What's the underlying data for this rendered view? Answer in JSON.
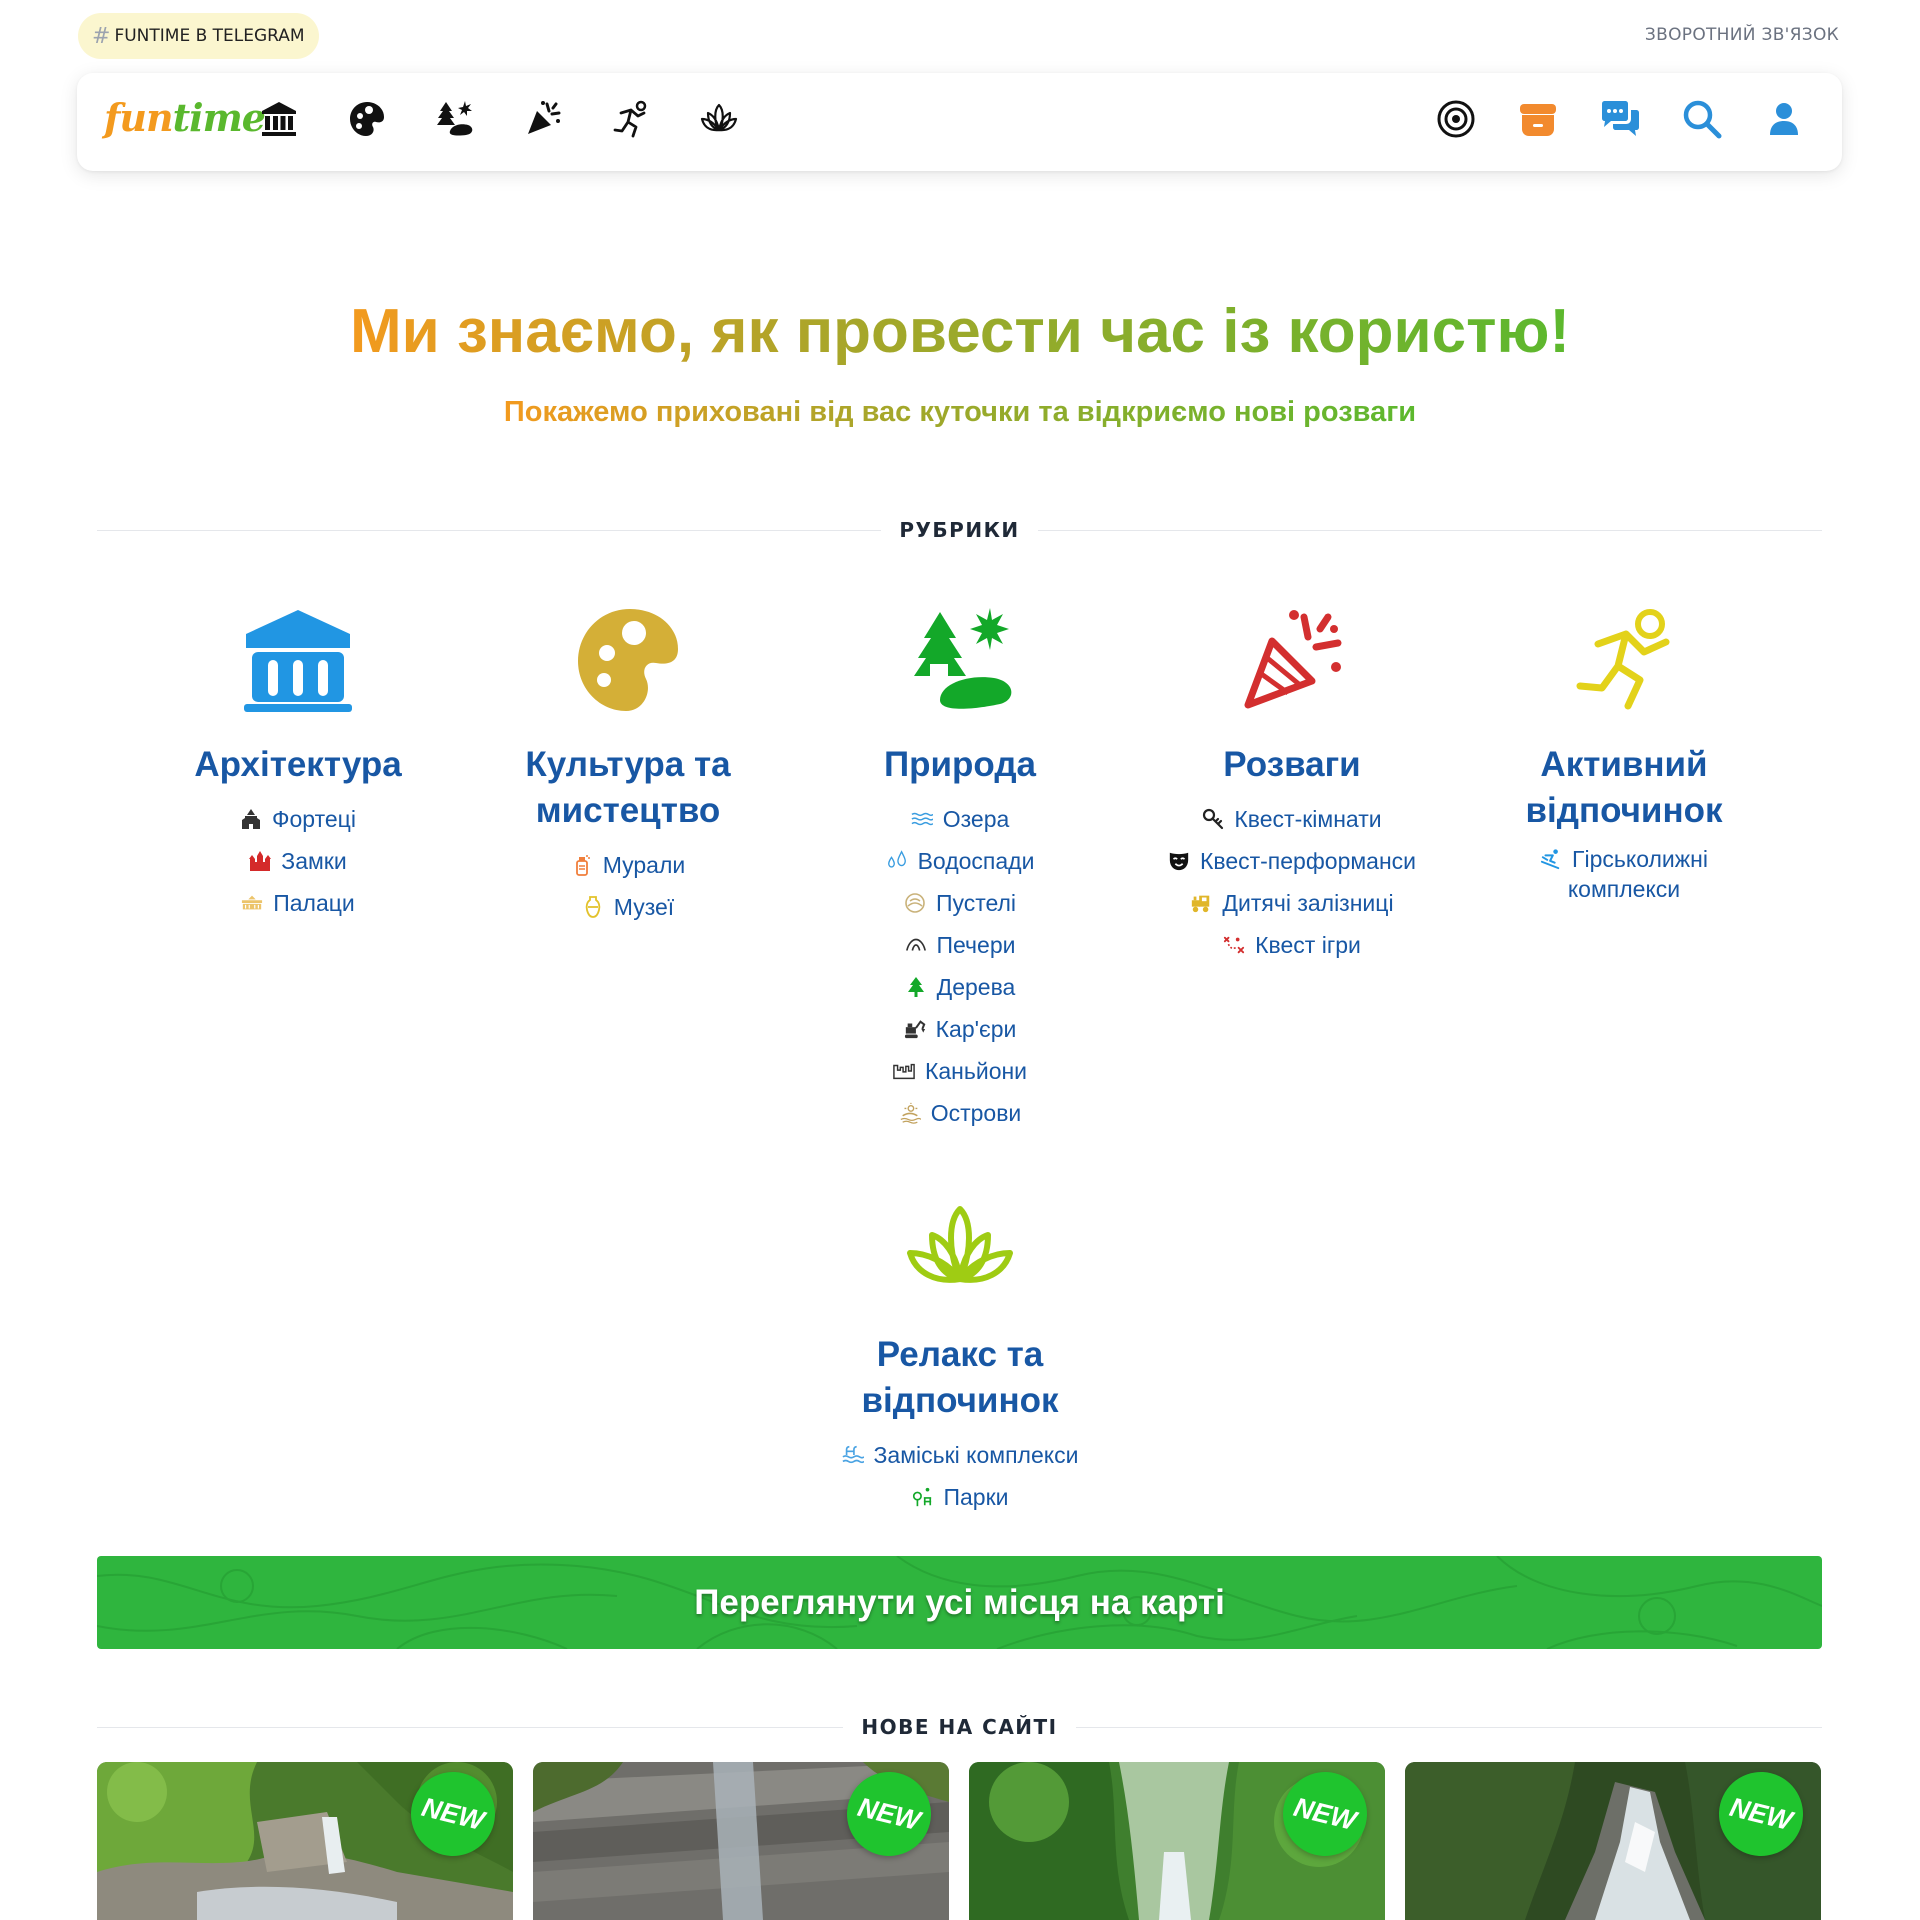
{
  "top": {
    "telegram_link": "FUNTIME B TELEGRAM",
    "hash": "#",
    "feedback_link": "ЗВОРОТНИЙ ЗВ'ЯЗОК"
  },
  "nav": {
    "logo_part1": "fun",
    "logo_part2": "time",
    "category_icons": [
      "architecture-icon",
      "palette-icon",
      "nature-icon",
      "party-popper-icon",
      "runner-icon",
      "lotus-icon"
    ],
    "right_icons": [
      "target-icon",
      "archive-box-icon",
      "chat-icon",
      "search-icon",
      "user-icon"
    ],
    "colors": {
      "orange": "#f39a1e",
      "blue": "#2b8fd9",
      "dark": "#1f2937"
    }
  },
  "hero": {
    "title": "Ми знаємо, як провести час із користю!",
    "subtitle": "Покажемо приховані від вас куточки та відкриємо нові розваги"
  },
  "sections": {
    "categories_label": "РУБРИКИ",
    "new_label": "НОВЕ НА САЙТІ"
  },
  "categories": [
    {
      "title": "Архітектура",
      "icon": "museum-icon",
      "color": "#2196e3",
      "items": [
        {
          "label": "Фортеці",
          "icon": "fortress-icon"
        },
        {
          "label": "Замки",
          "icon": "castle-icon"
        },
        {
          "label": "Палаци",
          "icon": "palace-icon"
        }
      ]
    },
    {
      "title_line1": "Культура та",
      "title_line2": "мистецтво",
      "icon": "palette-icon",
      "color": "#d4af37",
      "items": [
        {
          "label": "Мурали",
          "icon": "spray-can-icon"
        },
        {
          "label": "Музеї",
          "icon": "vase-icon"
        }
      ]
    },
    {
      "title": "Природа",
      "icon": "trees-icon",
      "color": "#13a829",
      "items": [
        {
          "label": "Озера",
          "icon": "waves-icon"
        },
        {
          "label": "Водоспади",
          "icon": "droplets-icon"
        },
        {
          "label": "Пустелі",
          "icon": "sand-icon"
        },
        {
          "label": "Печери",
          "icon": "cave-icon"
        },
        {
          "label": "Дерева",
          "icon": "tree-icon"
        },
        {
          "label": "Кар'єри",
          "icon": "excavator-icon"
        },
        {
          "label": "Каньйони",
          "icon": "canyon-icon"
        },
        {
          "label": "Острови",
          "icon": "island-icon"
        }
      ]
    },
    {
      "title": "Розваги",
      "icon": "party-popper-icon",
      "color": "#d32f2f",
      "items": [
        {
          "label": "Квест-кімнати",
          "icon": "key-icon"
        },
        {
          "label": "Квест-перформанси",
          "icon": "mask-icon"
        },
        {
          "label": "Дитячі залізниці",
          "icon": "train-icon"
        },
        {
          "label": "Квест ігри",
          "icon": "treasure-map-icon"
        }
      ]
    },
    {
      "title_line1": "Активний",
      "title_line2": "відпочинок",
      "icon": "runner-icon",
      "color": "#e3d21a",
      "items": [
        {
          "label_line1": "Гірськолижні",
          "label_line2": "комплекси",
          "icon": "skier-icon"
        }
      ]
    },
    {
      "title_line1": "Релакс та",
      "title_line2": "відпочинок",
      "icon": "lotus-icon",
      "color": "#9fcc13",
      "items": [
        {
          "label": "Заміські комплекси",
          "icon": "pool-icon"
        },
        {
          "label": "Парки",
          "icon": "park-icon"
        }
      ]
    }
  ],
  "map_banner": {
    "label": "Переглянути усі місця на карті",
    "color": "#2fb53e"
  },
  "new_cards": [
    {
      "badge": "NEW"
    },
    {
      "badge": "NEW"
    },
    {
      "badge": "NEW"
    },
    {
      "badge": "NEW"
    }
  ]
}
